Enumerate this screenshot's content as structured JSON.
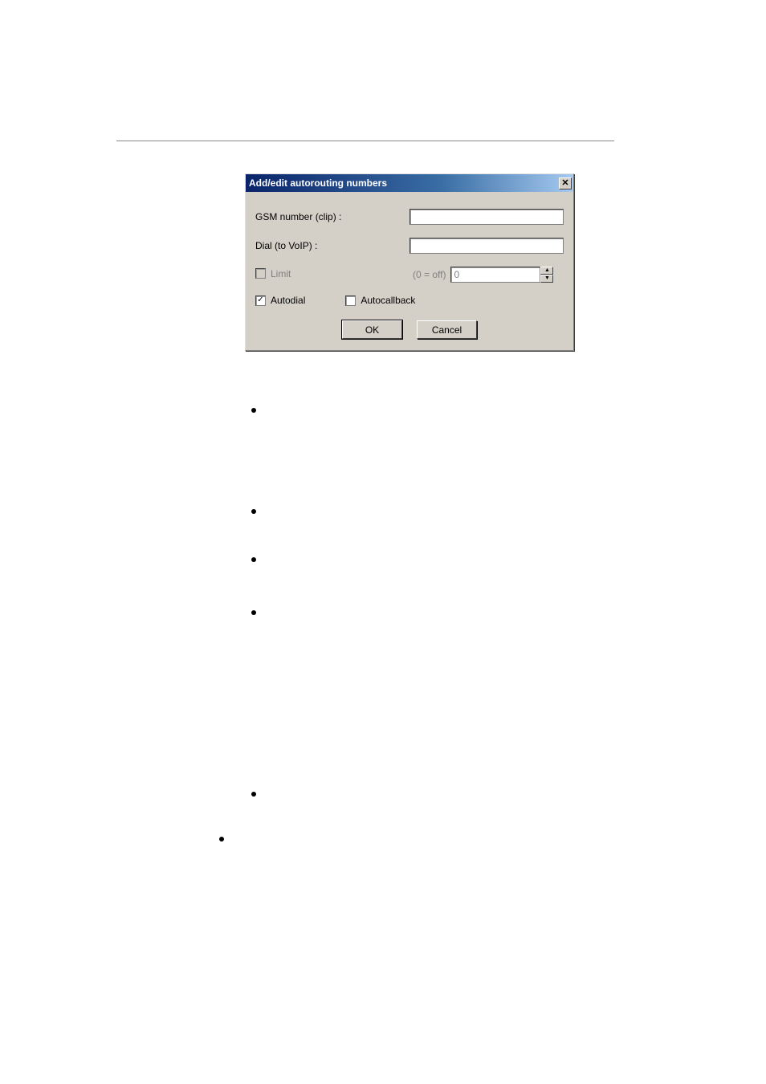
{
  "dialog": {
    "title": "Add/edit autorouting numbers",
    "gsm_label": "GSM number (clip) :",
    "dial_label": "Dial (to VoIP) :",
    "limit_label": "Limit",
    "limit_hint": "(0 = off)",
    "limit_value": "0",
    "autodial_label": "Autodial",
    "autocallback_label": "Autocallback",
    "ok_label": "OK",
    "cancel_label": "Cancel",
    "close_glyph": "✕",
    "check_glyph": "✓"
  }
}
